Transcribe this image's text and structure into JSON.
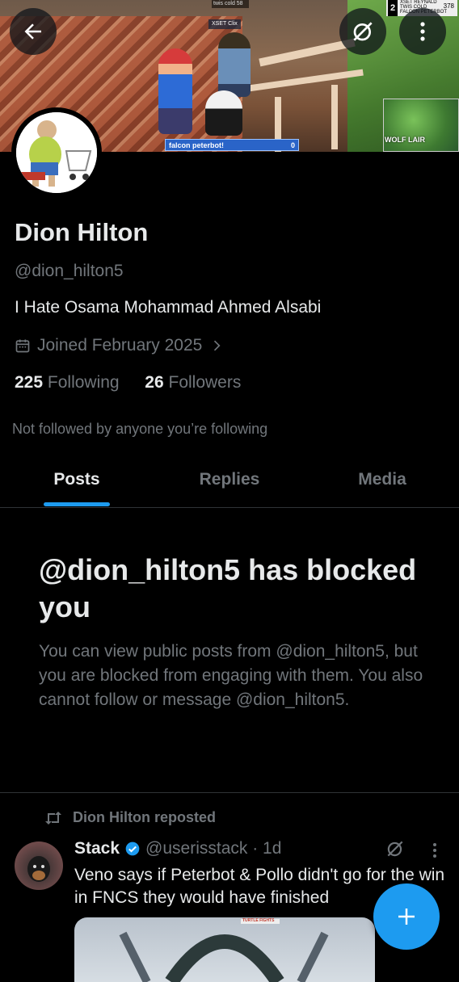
{
  "banner": {
    "hud_top": "twis cold 58",
    "hud_tag": "XSET Clix",
    "hud_right_rank": "2",
    "hud_right_lines": [
      "XSET REYNALD",
      "TWIS COLD",
      "FALCON PETERBOT"
    ],
    "hud_right_score": "378",
    "player_name": "falcon peterbot!",
    "player_points": "0",
    "map_label": "WOLF LAIR",
    "media_caption": "TURTLE FIGHTS"
  },
  "profile": {
    "name": "Dion Hilton",
    "handle": "@dion_hilton5",
    "bio": "I Hate Osama Mohammad Ahmed Alsabi",
    "joined": "Joined February 2025",
    "following_count": "225",
    "following_label": "Following",
    "followers_count": "26",
    "followers_label": "Followers",
    "not_followed": "Not followed by anyone you’re following"
  },
  "tabs": [
    "Posts",
    "Replies",
    "Media"
  ],
  "blocked": {
    "title": "@dion_hilton5 has blocked you",
    "body": "You can view public posts from @dion_hilton5, but you are blocked from engaging with them. You also cannot follow or message @dion_hilton5."
  },
  "tweet": {
    "repost_label": "Dion Hilton reposted",
    "author": "Stack",
    "handle_time": "@userisstack · 1d",
    "text": "Veno says if Peterbot & Pollo didn't go for the win in FNCS they would have finished"
  },
  "colors": {
    "accent": "#1d9bf0",
    "background": "#000000",
    "muted": "#71767b"
  }
}
